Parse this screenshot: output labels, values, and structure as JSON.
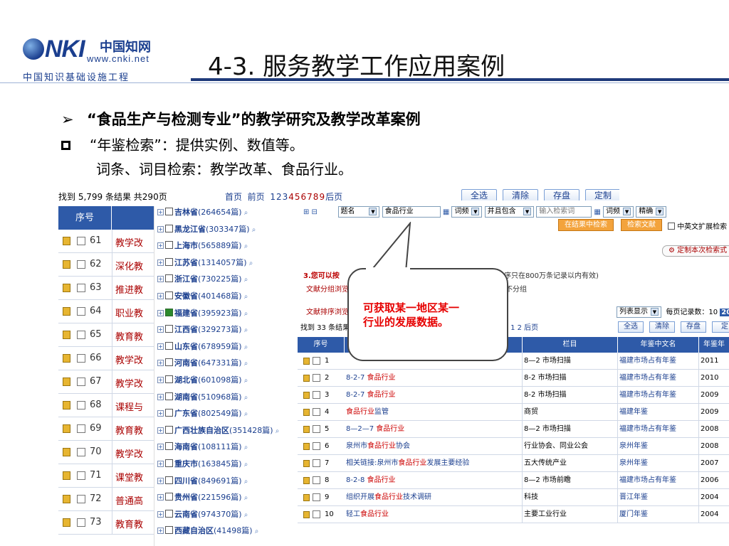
{
  "logo": {
    "brand": "NKI",
    "cn_name": "中国知网",
    "url": "www.cnki.net",
    "subtitle": "中国知识基础设施工程"
  },
  "slide": {
    "title": "4-3.  服务教学工作应用案例",
    "bullet1": "“食品生产与检测专业”的教学研究及教学改革案例",
    "bullet2": "“年鉴检索”：提供实例、数值等。",
    "bullet3": "词条、词目检索：教学改革、食品行业。"
  },
  "results_list": {
    "summary": "找到 5,799 条结果  共290页",
    "pager_first": "首页",
    "pager_prev": "前页",
    "pages": [
      "1",
      "2",
      "3",
      "4",
      "5",
      "6",
      "7",
      "8",
      "9"
    ],
    "pager_next": "后页",
    "buttons": {
      "select_all": "全选",
      "clear": "清除",
      "save": "存盘",
      "customize": "定制"
    },
    "column_header": "序号",
    "rows": [
      {
        "no": "61",
        "title": "教学改"
      },
      {
        "no": "62",
        "title": "深化教"
      },
      {
        "no": "63",
        "title": "推进教"
      },
      {
        "no": "64",
        "title": "职业教"
      },
      {
        "no": "65",
        "title": "教育教"
      },
      {
        "no": "66",
        "title": "教学改"
      },
      {
        "no": "67",
        "title": "教学改"
      },
      {
        "no": "68",
        "title": "课程与"
      },
      {
        "no": "69",
        "title": "教育教"
      },
      {
        "no": "70",
        "title": "教学改"
      },
      {
        "no": "71",
        "title": "课堂教"
      },
      {
        "no": "72",
        "title": "普通高"
      },
      {
        "no": "73",
        "title": "教育教"
      }
    ]
  },
  "provinces": [
    {
      "name": "吉林省",
      "count": "(264654篇)",
      "checked": false
    },
    {
      "name": "黑龙江省",
      "count": "(303347篇)",
      "checked": false
    },
    {
      "name": "上海市",
      "count": "(565889篇)",
      "checked": false
    },
    {
      "name": "江苏省",
      "count": "(1314057篇)",
      "checked": false
    },
    {
      "name": "浙江省",
      "count": "(730225篇)",
      "checked": false
    },
    {
      "name": "安徽省",
      "count": "(401468篇)",
      "checked": false
    },
    {
      "name": "福建省",
      "count": "(395923篇)",
      "checked": true
    },
    {
      "name": "江西省",
      "count": "(329273篇)",
      "checked": false
    },
    {
      "name": "山东省",
      "count": "(678959篇)",
      "checked": false
    },
    {
      "name": "河南省",
      "count": "(647331篇)",
      "checked": false
    },
    {
      "name": "湖北省",
      "count": "(601098篇)",
      "checked": false
    },
    {
      "name": "湖南省",
      "count": "(510968篇)",
      "checked": false
    },
    {
      "name": "广东省",
      "count": "(802549篇)",
      "checked": false
    },
    {
      "name": "广西壮族自治区",
      "count": "(351428篇)",
      "checked": false
    },
    {
      "name": "海南省",
      "count": "(108111篇)",
      "checked": false
    },
    {
      "name": "重庆市",
      "count": "(163845篇)",
      "checked": false
    },
    {
      "name": "四川省",
      "count": "(849691篇)",
      "checked": false
    },
    {
      "name": "贵州省",
      "count": "(221596篇)",
      "checked": false
    },
    {
      "name": "云南省",
      "count": "(974370篇)",
      "checked": false
    },
    {
      "name": "西藏自治区",
      "count": "(41498篇)",
      "checked": false
    }
  ],
  "yearbook": {
    "field_select": "题名",
    "field_value": "食品行业",
    "freq_label": "词频",
    "logic_select": "并且包含",
    "keyword_placeholder": "输入检索词",
    "match_select": "精确",
    "search_in_results": "在结果中检索",
    "search_docs": "检索文献",
    "ext_search": "中英文扩展检索",
    "custom_expr": "定制本次检索式",
    "tip_prefix": "3.您可以按",
    "tip_suffix": "条记录分组,排序只在800万条记录以内有效)",
    "group_label": "文献分组浏览",
    "no_group": "不分组",
    "sort_label": "文献排序浏览",
    "found": "找到 33 条结果",
    "pager_tail": "1 2 后页",
    "list_view": "列表显示",
    "per_page_label": "每页记录数：10",
    "per_page_20": "20",
    "buttons": {
      "select_all": "全选",
      "clear": "清除",
      "save": "存盘",
      "customize": "定"
    },
    "headers": {
      "no": "序号",
      "column": "栏目",
      "yearbook": "年鉴中文名",
      "year": "年鉴年"
    },
    "rows": [
      {
        "no": "1",
        "pre": "",
        "key": "",
        "post": "",
        "column": "8—2 市场扫描",
        "yearbook": "福建市场占有年鉴",
        "year": "2011"
      },
      {
        "no": "2",
        "pre": "8-2-7 ",
        "key": "食品行业",
        "post": "",
        "column": "8-2 市场扫描",
        "yearbook": "福建市场占有年鉴",
        "year": "2010"
      },
      {
        "no": "3",
        "pre": "8-2-7 ",
        "key": "食品行业",
        "post": "",
        "column": "8-2 市场扫描",
        "yearbook": "福建市场占有年鉴",
        "year": "2009"
      },
      {
        "no": "4",
        "pre": "",
        "key": "食品行业",
        "post": "监管",
        "column": "商贸",
        "yearbook": "福建年鉴",
        "year": "2009"
      },
      {
        "no": "5",
        "pre": "8—2—7 ",
        "key": "食品行业",
        "post": "",
        "column": "8—2 市场扫描",
        "yearbook": "福建市场占有年鉴",
        "year": "2008"
      },
      {
        "no": "6",
        "pre": "泉州市",
        "key": "食品行业",
        "post": "协会",
        "column": "行业协会、同业公会",
        "yearbook": "泉州年鉴",
        "year": "2008"
      },
      {
        "no": "7",
        "pre": "相关链接:泉州市",
        "key": "食品行业",
        "post": "发展主要经验",
        "column": "五大传统产业",
        "yearbook": "泉州年鉴",
        "year": "2007"
      },
      {
        "no": "8",
        "pre": "8-2-8 ",
        "key": "食品行业",
        "post": "",
        "column": "8—2 市场前瞻",
        "yearbook": "福建市场占有年鉴",
        "year": "2006"
      },
      {
        "no": "9",
        "pre": "组织开展",
        "key": "食品行业",
        "post": "技术调研",
        "column": "科技",
        "yearbook": "晋江年鉴",
        "year": "2004"
      },
      {
        "no": "10",
        "pre": "轻工",
        "key": "食品行业",
        "post": "",
        "column": "主要工业行业",
        "yearbook": "厦门年鉴",
        "year": "2004"
      }
    ]
  },
  "callout": {
    "line1": "可获取某一地区某一",
    "line2": "行业的发展数据。"
  },
  "colors": {
    "header_blue": "#2e5aa8",
    "title_rule": "#1f3a7a",
    "callout_red": "#e60000",
    "link_red": "#a00000"
  }
}
